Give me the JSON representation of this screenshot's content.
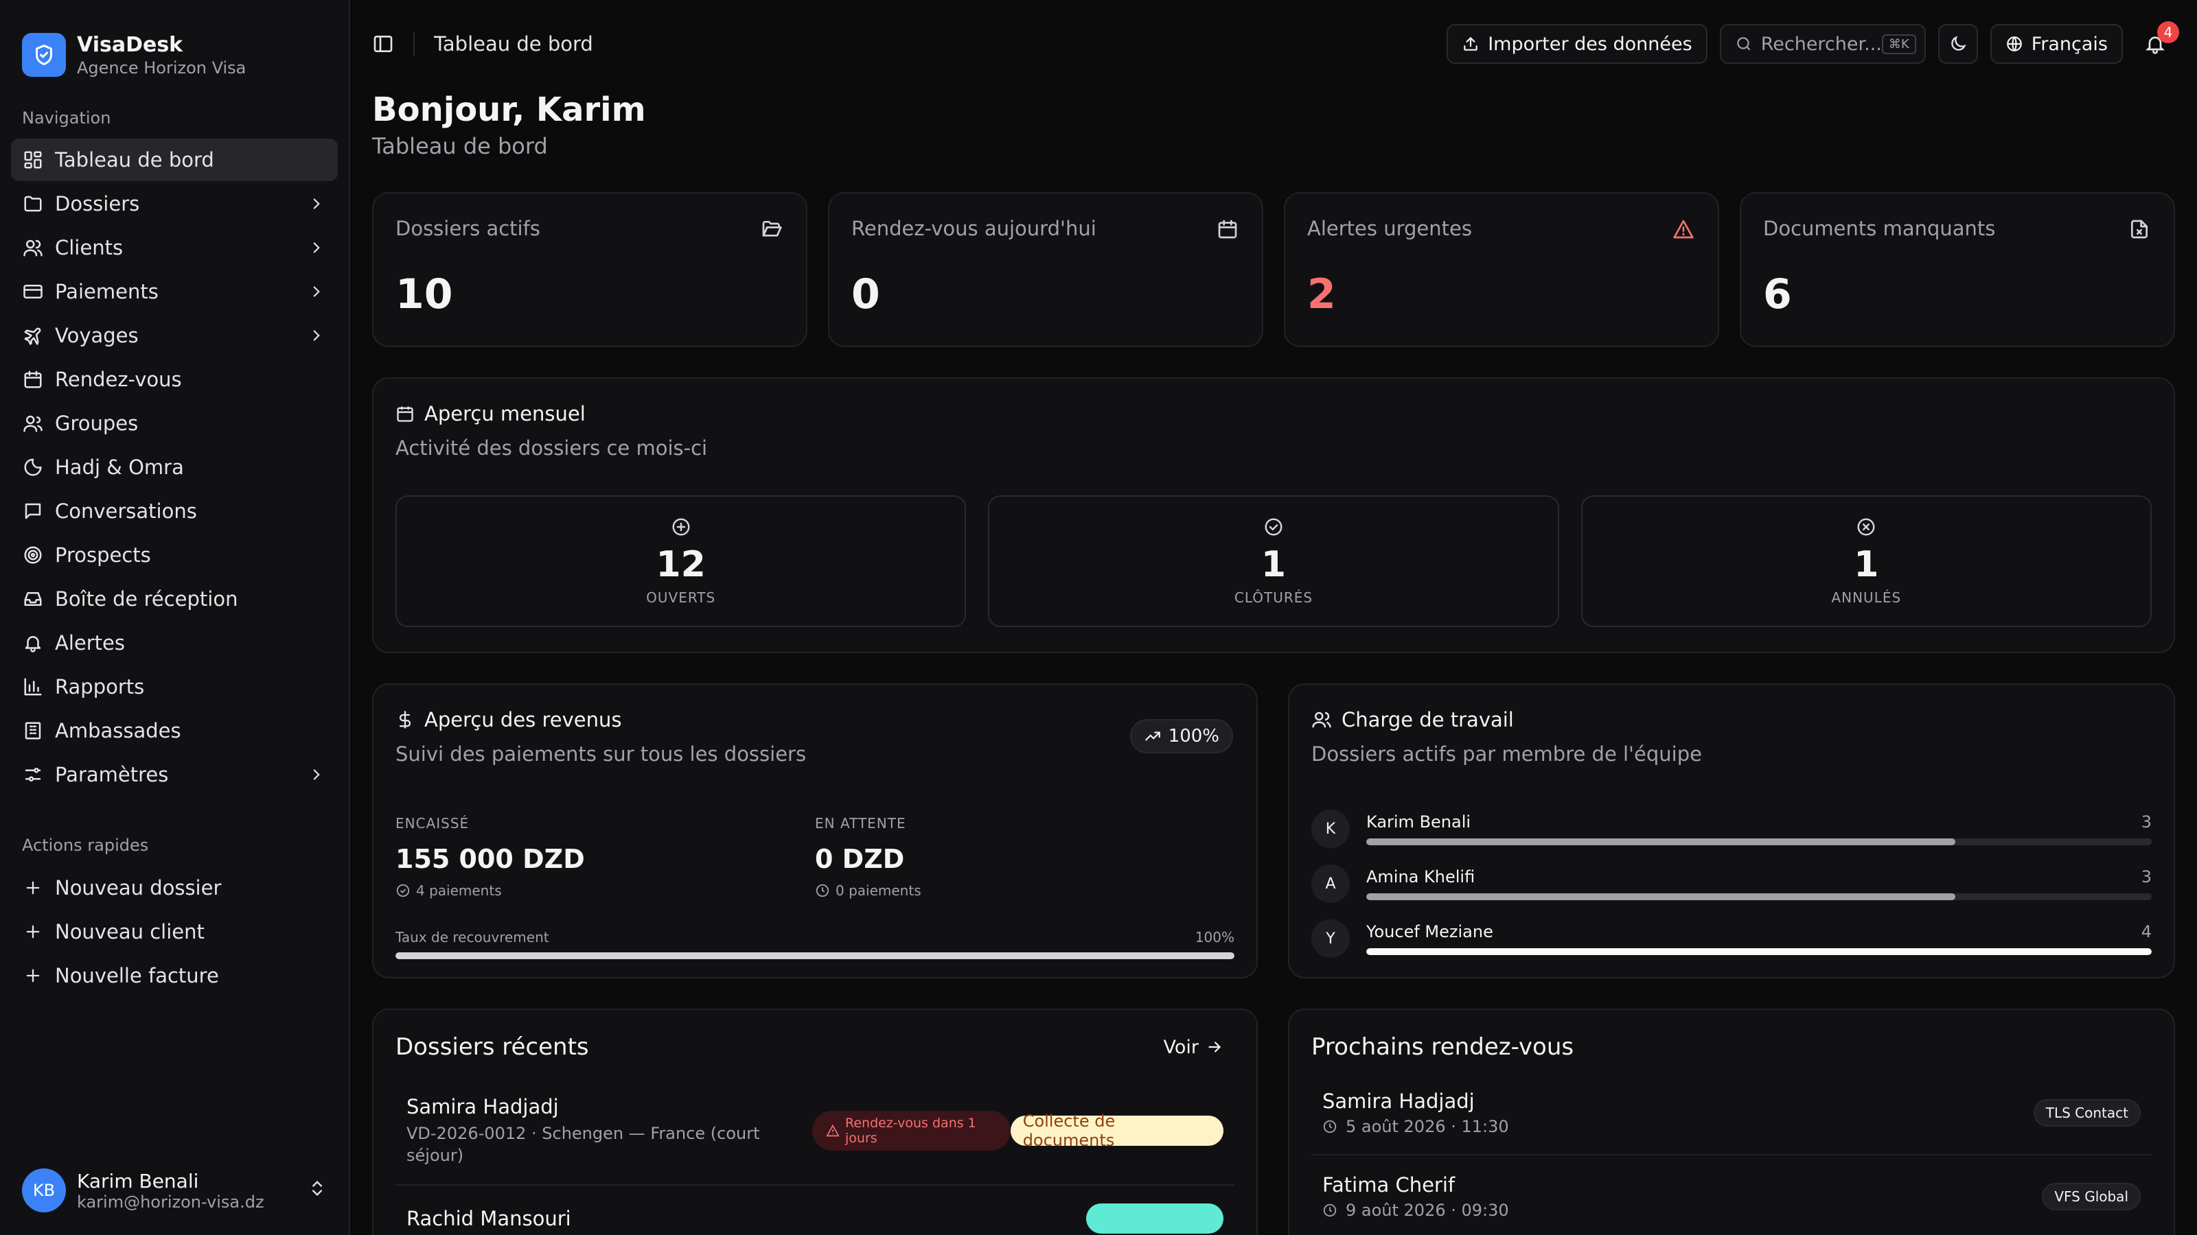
{
  "brand": {
    "name": "VisaDesk",
    "subtitle": "Agence Horizon Visa"
  },
  "sidebar": {
    "nav_label": "Navigation",
    "items": [
      {
        "label": "Tableau de bord",
        "icon": "dashboard-icon",
        "active": true
      },
      {
        "label": "Dossiers",
        "icon": "folder-icon",
        "chevron": true
      },
      {
        "label": "Clients",
        "icon": "users-icon",
        "chevron": true
      },
      {
        "label": "Paiements",
        "icon": "credit-card-icon",
        "chevron": true
      },
      {
        "label": "Voyages",
        "icon": "plane-icon",
        "chevron": true
      },
      {
        "label": "Rendez-vous",
        "icon": "calendar-icon"
      },
      {
        "label": "Groupes",
        "icon": "group-icon"
      },
      {
        "label": "Hadj & Omra",
        "icon": "moon-icon"
      },
      {
        "label": "Conversations",
        "icon": "message-icon"
      },
      {
        "label": "Prospects",
        "icon": "target-icon"
      },
      {
        "label": "Boîte de réception",
        "icon": "inbox-icon"
      },
      {
        "label": "Alertes",
        "icon": "bell-icon"
      },
      {
        "label": "Rapports",
        "icon": "bar-chart-icon"
      },
      {
        "label": "Ambassades",
        "icon": "building-icon"
      },
      {
        "label": "Paramètres",
        "icon": "settings-icon",
        "chevron": true
      }
    ],
    "quick_label": "Actions rapides",
    "quick": [
      {
        "label": "Nouveau dossier"
      },
      {
        "label": "Nouveau client"
      },
      {
        "label": "Nouvelle facture"
      }
    ],
    "user": {
      "initials": "KB",
      "name": "Karim Benali",
      "email": "karim@horizon-visa.dz"
    }
  },
  "topbar": {
    "breadcrumb": "Tableau de bord",
    "import_label": "Importer des données",
    "search_placeholder": "Rechercher...",
    "search_kbd": "⌘K",
    "language": "Français",
    "notifications": "4"
  },
  "header": {
    "greeting": "Bonjour, Karim",
    "subtitle": "Tableau de bord"
  },
  "stats": [
    {
      "title": "Dossiers actifs",
      "value": "10",
      "icon": "folder-open-icon"
    },
    {
      "title": "Rendez-vous aujourd'hui",
      "value": "0",
      "icon": "calendar-icon"
    },
    {
      "title": "Alertes urgentes",
      "value": "2",
      "icon": "alert-triangle-icon",
      "color": "#f87171"
    },
    {
      "title": "Documents manquants",
      "value": "6",
      "icon": "file-x-icon"
    }
  ],
  "monthly": {
    "title": "Aperçu mensuel",
    "subtitle": "Activité des dossiers ce mois-ci",
    "boxes": [
      {
        "value": "12",
        "label": "OUVERTS",
        "icon": "plus-circle-icon"
      },
      {
        "value": "1",
        "label": "CLÔTURÉS",
        "icon": "check-circle-icon"
      },
      {
        "value": "1",
        "label": "ANNULÉS",
        "icon": "x-circle-icon"
      }
    ]
  },
  "revenue": {
    "title": "Aperçu des revenus",
    "subtitle": "Suivi des paiements sur tous les dossiers",
    "badge": "100%",
    "collected_label": "ENCAISSÉ",
    "collected_value": "155 000 DZD",
    "collected_note": "4 paiements",
    "pending_label": "EN ATTENTE",
    "pending_value": "0 DZD",
    "pending_note": "0 paiements",
    "rate_label": "Taux de recouvrement",
    "rate_value": "100%",
    "rate_fraction": 1.0
  },
  "workload": {
    "title": "Charge de travail",
    "subtitle": "Dossiers actifs par membre de l'équipe",
    "members": [
      {
        "initial": "K",
        "name": "Karim Benali",
        "count": "3",
        "fraction": 0.75
      },
      {
        "initial": "A",
        "name": "Amina Khelifi",
        "count": "3",
        "fraction": 0.75
      },
      {
        "initial": "Y",
        "name": "Youcef Meziane",
        "count": "4",
        "fraction": 1.0
      }
    ]
  },
  "recent": {
    "title": "Dossiers récents",
    "view_label": "Voir",
    "rows": [
      {
        "name": "Samira Hadjadj",
        "ref": "VD-2026-0012 · Schengen — France (court séjour)",
        "alert": "Rendez-vous dans 1 jours",
        "status": "Collecte de documents"
      },
      {
        "name": "Rachid Mansouri"
      }
    ]
  },
  "upcoming": {
    "title": "Prochains rendez-vous",
    "items": [
      {
        "name": "Samira Hadjadj",
        "date": "5 août 2026 · 11:30",
        "tag": "TLS Contact"
      },
      {
        "name": "Fatima Cherif",
        "date": "9 août 2026 · 09:30",
        "tag": "VFS Global"
      }
    ]
  }
}
